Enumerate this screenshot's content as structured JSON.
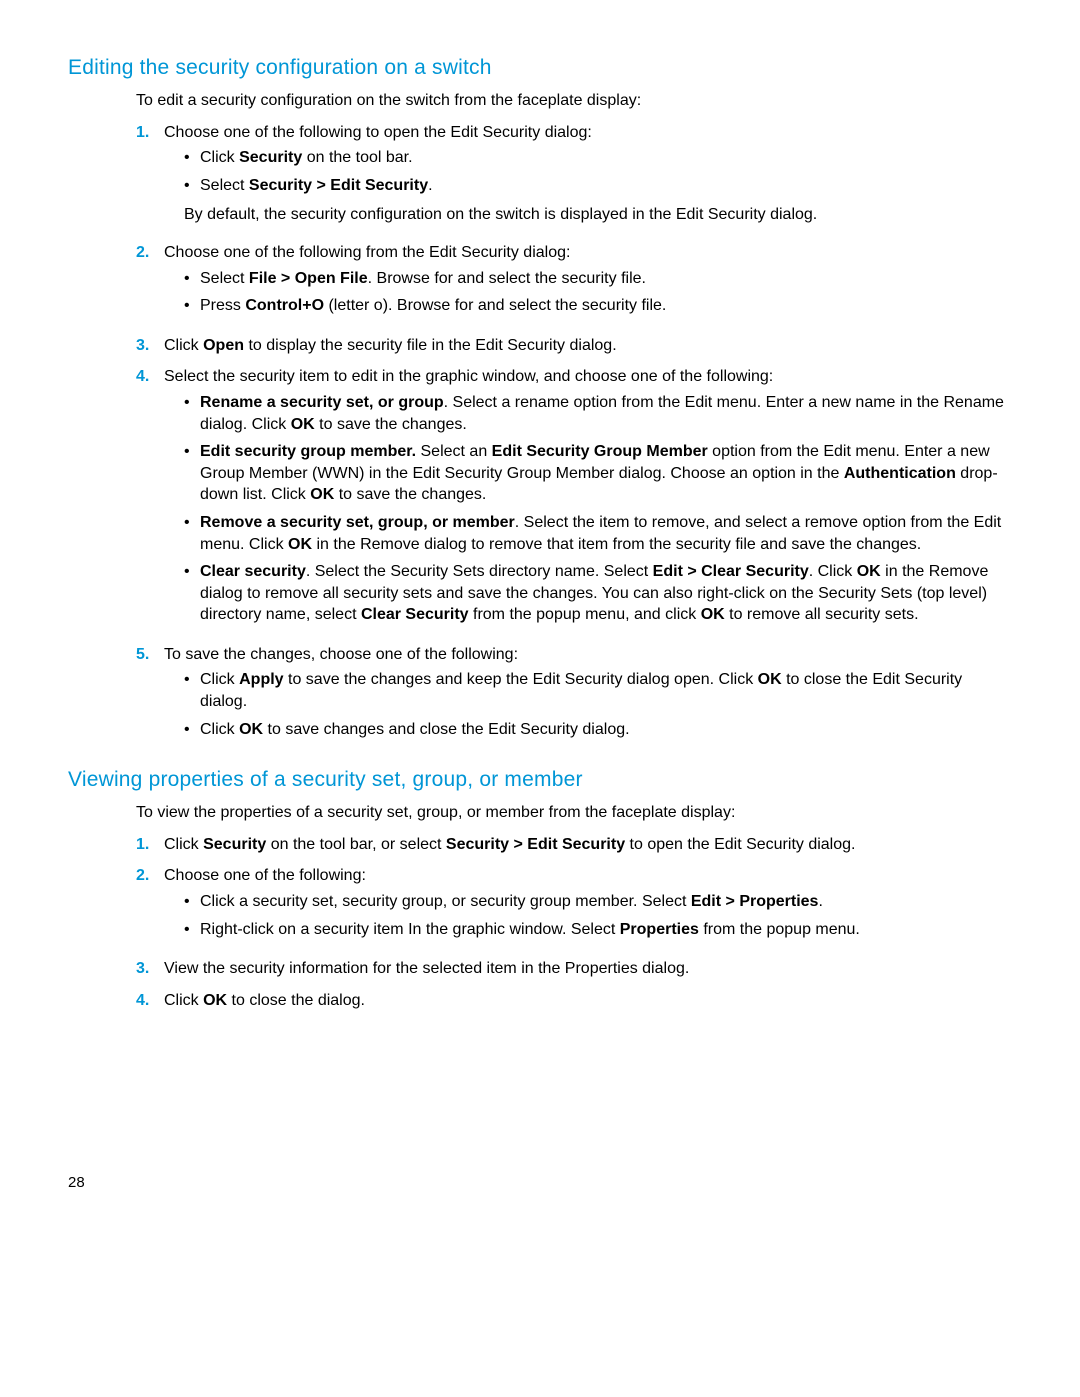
{
  "page_number": "28",
  "section1": {
    "title": "Editing the security configuration on a switch",
    "intro": "To edit a security configuration on the switch from the faceplate display:",
    "step1": {
      "text": "Choose one of the following to open the Edit Security dialog:",
      "b1_pre": "Click ",
      "b1_bold": "Security",
      "b1_post": " on the tool bar.",
      "b2_pre": "Select ",
      "b2_bold": "Security > Edit Security",
      "b2_post": ".",
      "note": "By default, the security configuration on the switch is displayed in the Edit Security dialog."
    },
    "step2": {
      "text": "Choose one of the following from the Edit Security dialog:",
      "b1_pre": "Select ",
      "b1_bold": "File > Open File",
      "b1_post": ". Browse for and select the security file.",
      "b2_pre": "Press ",
      "b2_bold": "Control+O",
      "b2_post": " (letter o). Browse for and select the security file."
    },
    "step3_pre": "Click ",
    "step3_bold": "Open",
    "step3_post": " to display the security file in the Edit Security dialog.",
    "step4": {
      "text": "Select the security item to edit in the graphic window, and choose one of the following:",
      "b1_bold1": "Rename a security set, or group",
      "b1_mid": ". Select a rename option from the Edit menu. Enter a new name in the Rename dialog. Click ",
      "b1_bold2": "OK",
      "b1_post": " to save the changes.",
      "b2_bold1": "Edit security group member.",
      "b2_mid1": " Select an ",
      "b2_bold2": "Edit Security Group Member",
      "b2_mid2": " option from the Edit menu. Enter a new Group Member (WWN) in the Edit Security Group Member dialog. Choose an option in the ",
      "b2_bold3": "Authentication",
      "b2_mid3": " drop-down list. Click ",
      "b2_bold4": "OK",
      "b2_post": " to save the changes.",
      "b3_bold1": "Remove a security set, group, or member",
      "b3_mid1": ". Select the item to remove, and select a remove option from the Edit menu. Click ",
      "b3_bold2": "OK",
      "b3_post": " in the Remove dialog to remove that item from the security file and save the changes.",
      "b4_bold1": "Clear security",
      "b4_mid1": ". Select the Security Sets directory name. Select ",
      "b4_bold2": "Edit > Clear Security",
      "b4_mid2": ". Click ",
      "b4_bold3": "OK",
      "b4_mid3": " in the Remove dialog to remove all security sets and save the changes. You can also right-click on the Security Sets (top level) directory name, select ",
      "b4_bold4": "Clear Security",
      "b4_mid4": " from the popup menu, and click ",
      "b4_bold5": "OK",
      "b4_post": " to remove all security sets."
    },
    "step5": {
      "text": "To save the changes, choose one of the following:",
      "b1_pre": "Click ",
      "b1_bold1": "Apply",
      "b1_mid": " to save the changes and keep the Edit Security dialog open. Click ",
      "b1_bold2": "OK",
      "b1_post": " to close the Edit Security dialog.",
      "b2_pre": "Click ",
      "b2_bold": "OK",
      "b2_post": " to save changes and close the Edit Security dialog."
    }
  },
  "section2": {
    "title": "Viewing properties of a security set, group, or member",
    "intro": "To view the properties of a security set, group, or member from the faceplate display:",
    "step1_pre": "Click ",
    "step1_bold1": "Security",
    "step1_mid": " on the tool bar, or select ",
    "step1_bold2": "Security > Edit Security",
    "step1_post": " to open the Edit Security dialog.",
    "step2": {
      "text": "Choose one of the following:",
      "b1_pre": "Click a security set, security group, or security group member. Select ",
      "b1_bold": "Edit > Properties",
      "b1_post": ".",
      "b2_pre": "Right-click on a security item In the graphic window. Select ",
      "b2_bold": "Properties",
      "b2_post": " from the popup menu."
    },
    "step3": "View the security information for the selected item in the Properties dialog.",
    "step4_pre": "Click ",
    "step4_bold": "OK",
    "step4_post": " to close the dialog."
  }
}
